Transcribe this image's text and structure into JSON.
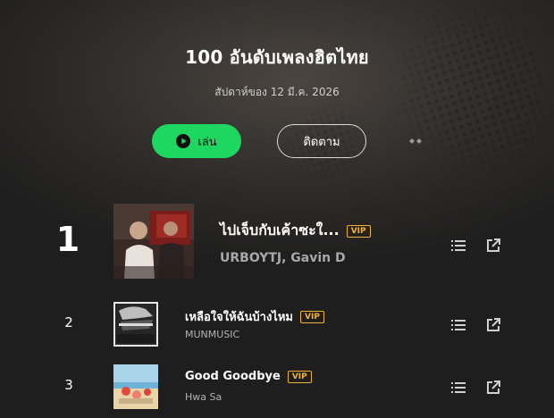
{
  "header": {
    "title": "100 อันดับเพลงฮิตไทย",
    "subtitle": "สัปดาห์ของ 12 มี.ค. 2026"
  },
  "actions": {
    "play_label": "เล่น",
    "follow_label": "ติดตาม"
  },
  "colors": {
    "accent": "#1ed760",
    "vip": "#f2b134",
    "background": "#1e1e1e"
  },
  "tracks": [
    {
      "rank": "1",
      "title": "ไปเจ็บกับเค้าซะใ...",
      "artist": "URBOYTJ, Gavin D",
      "badge": "VIP"
    },
    {
      "rank": "2",
      "title": "เหลือใจให้ฉันบ้างไหม",
      "artist": "MUNMUSIC",
      "badge": "VIP"
    },
    {
      "rank": "3",
      "title": "Good Goodbye",
      "artist": "Hwa Sa",
      "badge": "VIP"
    }
  ],
  "icons": {
    "play": "play-circle-icon",
    "more": "more-dots-icon",
    "queue": "queue-list-icon",
    "share": "external-link-icon"
  }
}
